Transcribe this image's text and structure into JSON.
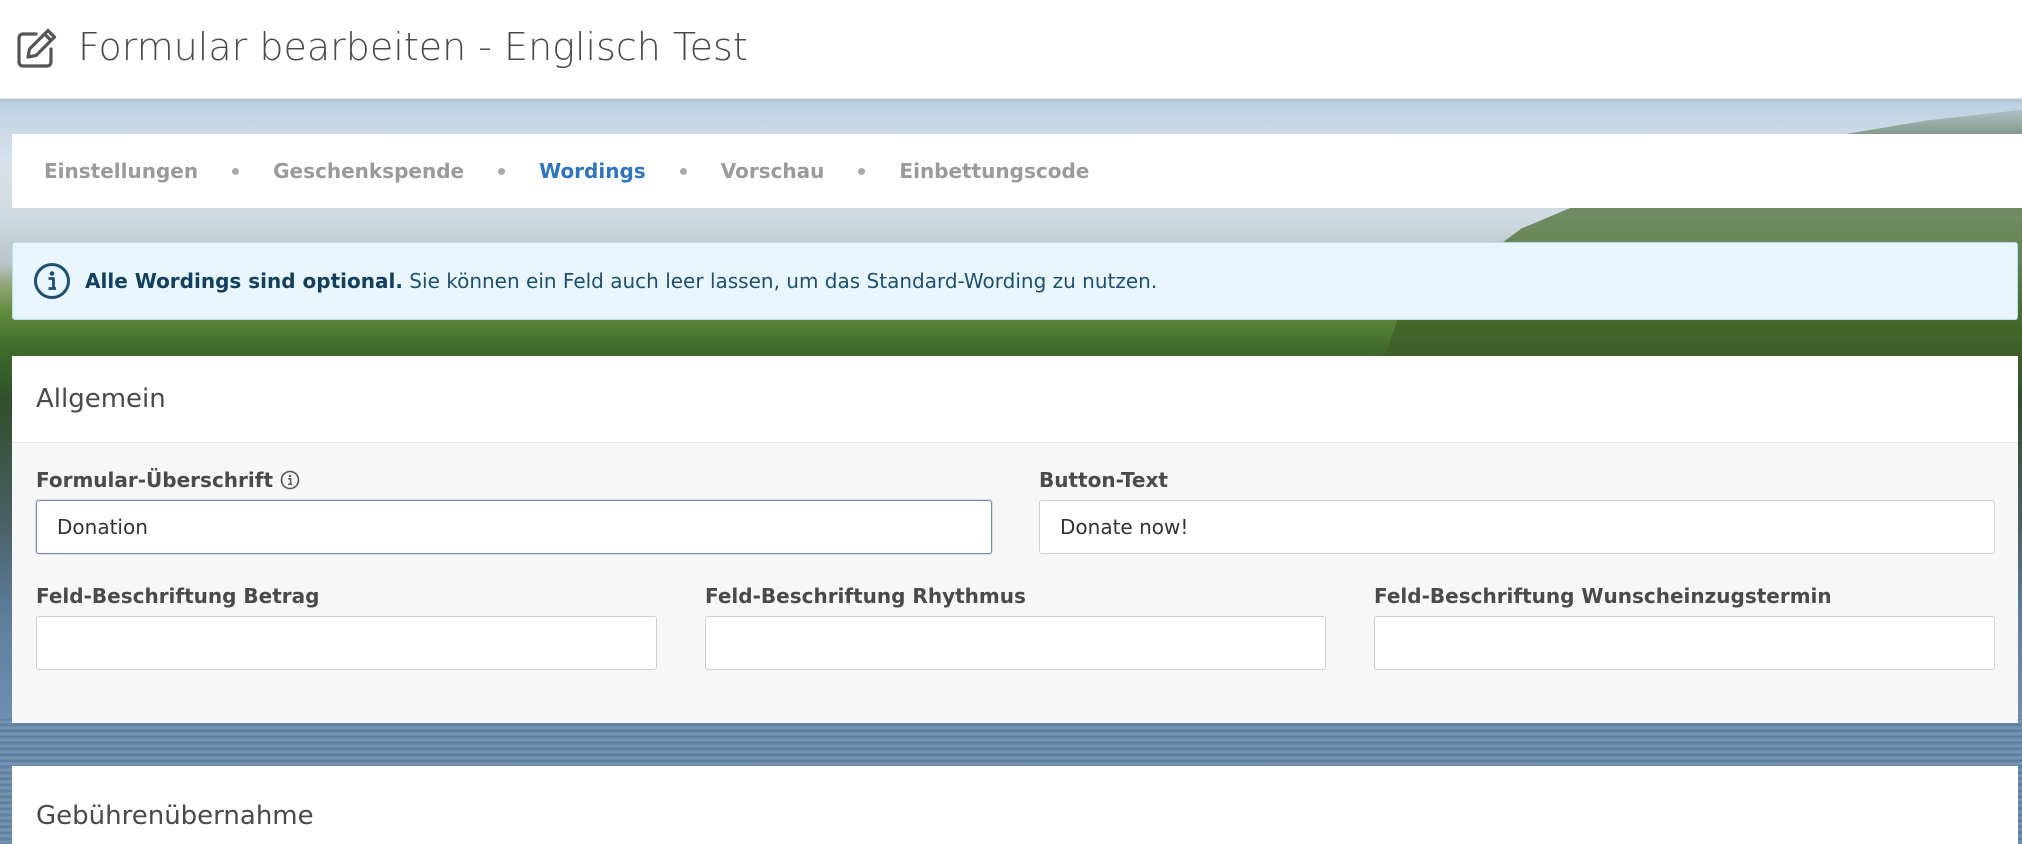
{
  "header": {
    "title": "Formular bearbeiten - Englisch Test",
    "icon": "edit-icon"
  },
  "steps": [
    {
      "label": "Einstellungen",
      "active": false
    },
    {
      "label": "Geschenkspende",
      "active": false
    },
    {
      "label": "Wordings",
      "active": true
    },
    {
      "label": "Vorschau",
      "active": false
    },
    {
      "label": "Einbettungscode",
      "active": false
    }
  ],
  "alert": {
    "icon": "info-circle-icon",
    "bold_text": "Alle Wordings sind optional.",
    "text": " Sie können ein Feld auch leer lassen, um das Standard-Wording zu nutzen."
  },
  "general": {
    "title": "Allgemein",
    "fields": {
      "form_heading": {
        "label": "Formular-Überschrift",
        "value": "Donation",
        "has_info_icon": true
      },
      "button_text": {
        "label": "Button-Text",
        "value": "Donate now!"
      },
      "amount_label": {
        "label": "Feld-Beschriftung Betrag",
        "value": ""
      },
      "rhythm_label": {
        "label": "Feld-Beschriftung Rhythmus",
        "value": ""
      },
      "collection_date_label": {
        "label": "Feld-Beschriftung Wunscheinzugstermin",
        "value": ""
      }
    }
  },
  "fees": {
    "title": "Gebührenübernahme"
  },
  "colors": {
    "accent": "#2f74c0",
    "alert_bg": "#e8f5fc",
    "alert_text": "#1f4f6f"
  }
}
